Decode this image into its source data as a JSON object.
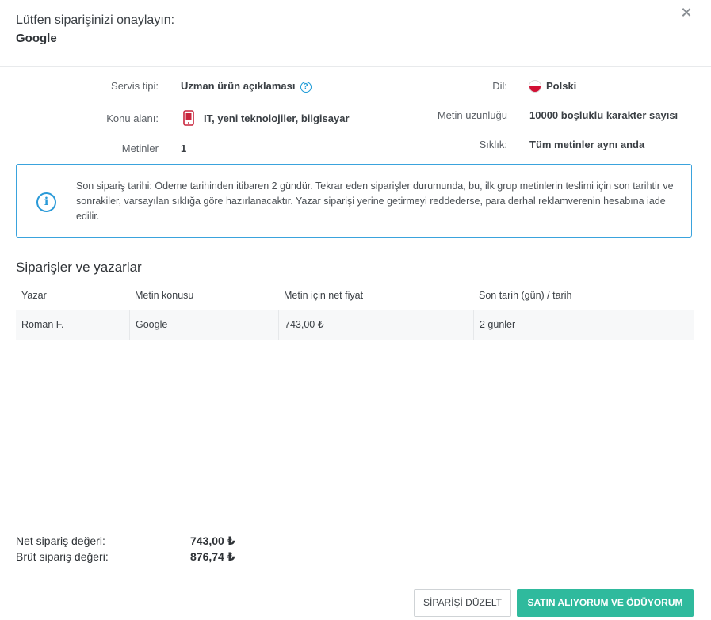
{
  "header": {
    "title": "Lütfen siparişinizi onaylayın:",
    "subtitle": "Google"
  },
  "details": {
    "service_type_label": "Servis tipi:",
    "service_type_value": "Uzman ürün açıklaması",
    "topic_label": "Konu alanı:",
    "topic_value": "IT, yeni teknolojiler, bilgisayar",
    "texts_label": "Metinler",
    "texts_value": "1",
    "language_label": "Dil:",
    "language_value": "Polski",
    "length_label": "Metin uzunluğu",
    "length_value": "10000 boşluklu karakter sayısı",
    "frequency_label": "Sıklık:",
    "frequency_value": "Tüm metinler aynı anda"
  },
  "info": {
    "text": "Son sipariş tarihi: Ödeme tarihinden itibaren 2 gündür. Tekrar eden siparişler durumunda, bu, ilk grup metinlerin teslimi için son tarihtir ve sonrakiler, varsayılan sıklığa göre hazırlanacaktır. Yazar siparişi yerine getirmeyi reddederse, para derhal reklamverenin hesabına iade edilir."
  },
  "orders": {
    "title": "Siparişler ve yazarlar",
    "columns": [
      "Yazar",
      "Metin konusu",
      "Metin için net fiyat",
      "Son tarih (gün) / tarih"
    ],
    "rows": [
      [
        "Roman F.",
        "Google",
        "743,00 ₺",
        "2 günler"
      ]
    ]
  },
  "totals": {
    "net_label": "Net sipariş değeri:",
    "net_value": "743,00 ₺",
    "gross_label": "Brüt sipariş değeri:",
    "gross_value": "876,74 ₺"
  },
  "footer": {
    "edit_label": "SİPARİŞİ DÜZELT",
    "confirm_label": "SATIN ALIYORUM VE ÖDÜYORUM"
  },
  "colors": {
    "accent_blue": "#2a9ad8",
    "primary_green": "#2fba9d",
    "topic_icon": "#c8243c"
  }
}
